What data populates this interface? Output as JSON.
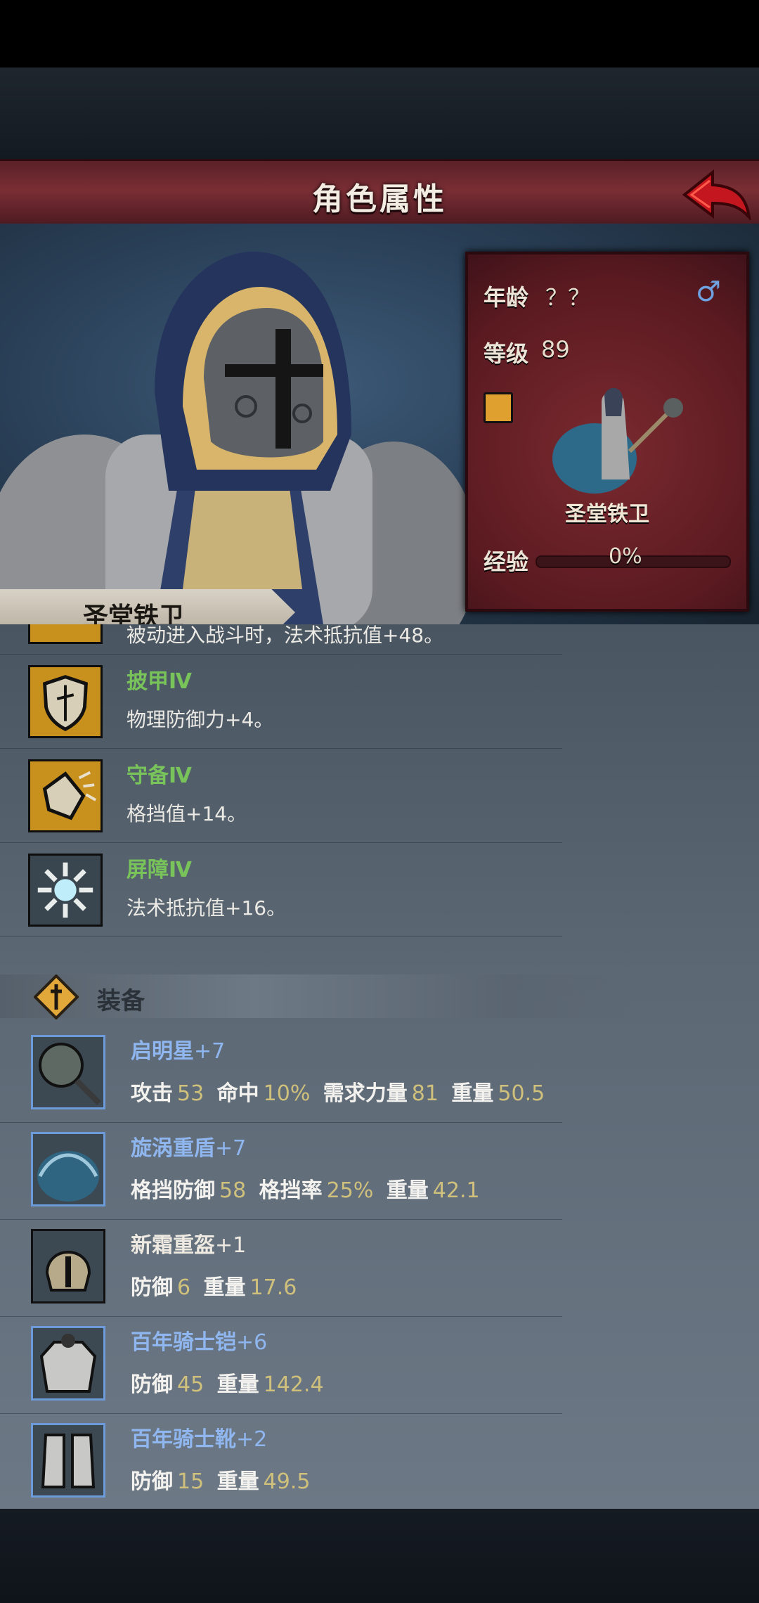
{
  "header": {
    "title": "角色属性"
  },
  "hero": {
    "name": "圣堂铁卫",
    "age_label": "年龄",
    "age_value": "？？",
    "level_label": "等级",
    "level_value": "89",
    "class_name": "圣堂铁卫",
    "exp_label": "经验",
    "exp_value": "0%",
    "exp_progress": 0
  },
  "skills": {
    "cut_text": "被动进入战斗时，法术抵抗值+48。",
    "items": [
      {
        "name": "披甲Ⅳ",
        "desc": "物理防御力+4。",
        "icon": "shield-rune-icon"
      },
      {
        "name": "守备Ⅳ",
        "desc": "格挡值+14。",
        "icon": "block-shatter-icon"
      },
      {
        "name": "屏障Ⅳ",
        "desc": "法术抵抗值+16。",
        "icon": "barrier-burst-icon"
      }
    ]
  },
  "equipment": {
    "title": "装备",
    "items": [
      {
        "name": "启明星",
        "plus": "+7",
        "icon": "morning-star-icon",
        "stats": [
          [
            "攻击",
            "53"
          ],
          [
            "命中",
            "10%"
          ],
          [
            "需求力量",
            "81"
          ],
          [
            "重量",
            "50.5"
          ]
        ]
      },
      {
        "name": "旋涡重盾",
        "plus": "+7",
        "icon": "feather-shield-icon",
        "stats": [
          [
            "格挡防御",
            "58"
          ],
          [
            "格挡率",
            "25%"
          ],
          [
            "重量",
            "42.1"
          ]
        ]
      },
      {
        "name": "新霜重盔",
        "plus": "+1",
        "icon": "helmet-icon",
        "stats": [
          [
            "防御",
            "6"
          ],
          [
            "重量",
            "17.6"
          ]
        ]
      },
      {
        "name": "百年骑士铠",
        "plus": "+6",
        "icon": "plate-armor-icon",
        "stats": [
          [
            "防御",
            "45"
          ],
          [
            "重量",
            "142.4"
          ]
        ]
      },
      {
        "name": "百年骑士靴",
        "plus": "+2",
        "icon": "boots-icon",
        "stats": [
          [
            "防御",
            "15"
          ],
          [
            "重量",
            "49.5"
          ]
        ]
      }
    ]
  },
  "colors": {
    "title_bar": "#7a2e34",
    "skill_name": "#79c45a",
    "equip_name": "#8fb6ef",
    "stat_value": "#cfc07c"
  }
}
